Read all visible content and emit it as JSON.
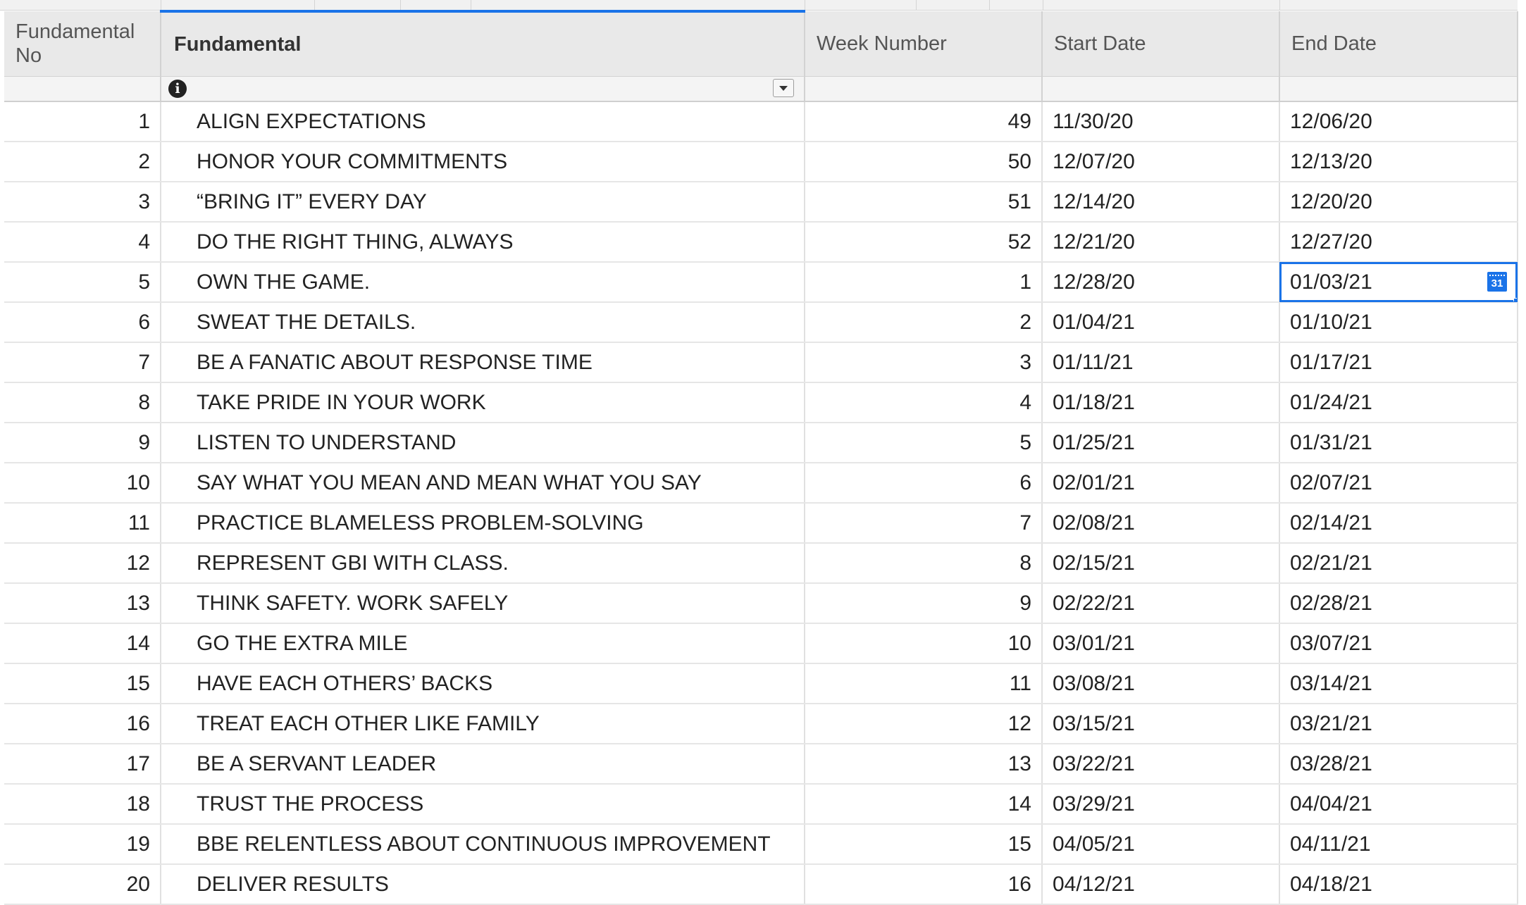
{
  "columns": {
    "fundamental_no": "Fundamental No",
    "fundamental": "Fundamental",
    "week_number": "Week Number",
    "start_date": "Start Date",
    "end_date": "End Date"
  },
  "icons": {
    "info": "info-icon",
    "dropdown": "chevron-down-icon",
    "calendar": "calendar-icon",
    "calendar_day": "31"
  },
  "colors": {
    "accent": "#1a73e8",
    "header_bg": "#e9e9e9"
  },
  "selected_cell": {
    "row": 5,
    "column": "end_date"
  },
  "rows": [
    {
      "no": "1",
      "fundamental": "ALIGN EXPECTATIONS",
      "week": "49",
      "start": "11/30/20",
      "end": "12/06/20"
    },
    {
      "no": "2",
      "fundamental": "HONOR YOUR COMMITMENTS",
      "week": "50",
      "start": "12/07/20",
      "end": "12/13/20"
    },
    {
      "no": "3",
      "fundamental": "“BRING IT” EVERY DAY",
      "week": "51",
      "start": "12/14/20",
      "end": "12/20/20"
    },
    {
      "no": "4",
      "fundamental": "DO THE RIGHT THING, ALWAYS",
      "week": "52",
      "start": "12/21/20",
      "end": "12/27/20"
    },
    {
      "no": "5",
      "fundamental": "OWN THE GAME.",
      "week": "1",
      "start": "12/28/20",
      "end": "01/03/21"
    },
    {
      "no": "6",
      "fundamental": "SWEAT THE DETAILS.",
      "week": "2",
      "start": "01/04/21",
      "end": "01/10/21"
    },
    {
      "no": "7",
      "fundamental": "BE A FANATIC ABOUT RESPONSE TIME",
      "week": "3",
      "start": "01/11/21",
      "end": "01/17/21"
    },
    {
      "no": "8",
      "fundamental": "TAKE PRIDE IN YOUR WORK",
      "week": "4",
      "start": "01/18/21",
      "end": "01/24/21"
    },
    {
      "no": "9",
      "fundamental": "LISTEN TO UNDERSTAND",
      "week": "5",
      "start": "01/25/21",
      "end": "01/31/21"
    },
    {
      "no": "10",
      "fundamental": "SAY WHAT YOU MEAN AND MEAN WHAT YOU SAY",
      "week": "6",
      "start": "02/01/21",
      "end": "02/07/21"
    },
    {
      "no": "11",
      "fundamental": "PRACTICE BLAMELESS PROBLEM-SOLVING",
      "week": "7",
      "start": "02/08/21",
      "end": "02/14/21"
    },
    {
      "no": "12",
      "fundamental": "REPRESENT GBI WITH CLASS.",
      "week": "8",
      "start": "02/15/21",
      "end": "02/21/21"
    },
    {
      "no": "13",
      "fundamental": "THINK SAFETY. WORK SAFELY",
      "week": "9",
      "start": "02/22/21",
      "end": "02/28/21"
    },
    {
      "no": "14",
      "fundamental": "GO THE EXTRA MILE",
      "week": "10",
      "start": "03/01/21",
      "end": "03/07/21"
    },
    {
      "no": "15",
      "fundamental": "HAVE EACH OTHERS’ BACKS",
      "week": "11",
      "start": "03/08/21",
      "end": "03/14/21"
    },
    {
      "no": "16",
      "fundamental": "TREAT EACH OTHER LIKE FAMILY",
      "week": "12",
      "start": "03/15/21",
      "end": "03/21/21"
    },
    {
      "no": "17",
      "fundamental": "BE A SERVANT LEADER",
      "week": "13",
      "start": "03/22/21",
      "end": "03/28/21"
    },
    {
      "no": "18",
      "fundamental": "TRUST THE PROCESS",
      "week": "14",
      "start": "03/29/21",
      "end": "04/04/21"
    },
    {
      "no": "19",
      "fundamental": "BBE RELENTLESS ABOUT CONTINUOUS IMPROVEMENT",
      "week": "15",
      "start": "04/05/21",
      "end": "04/11/21"
    },
    {
      "no": "20",
      "fundamental": "DELIVER RESULTS",
      "week": "16",
      "start": "04/12/21",
      "end": "04/18/21"
    }
  ]
}
